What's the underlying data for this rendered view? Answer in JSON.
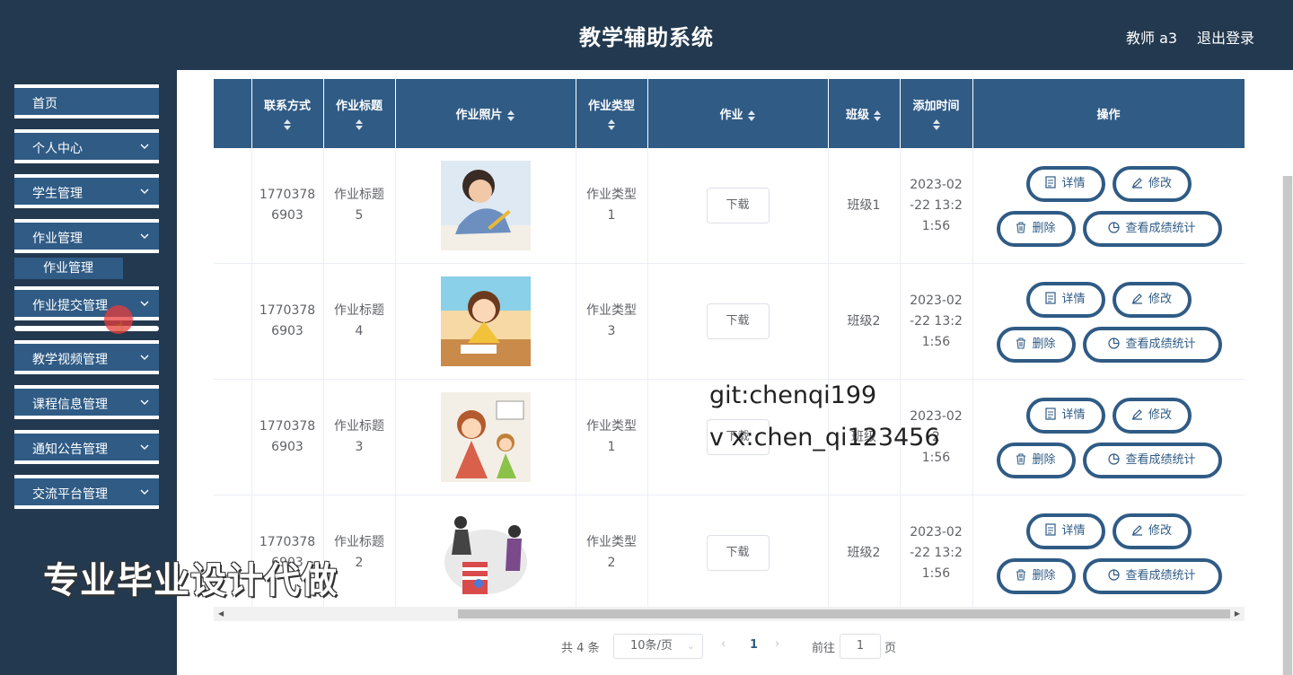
{
  "header": {
    "title": "教学辅助系统",
    "user": "教师 a3",
    "logout": "退出登录"
  },
  "sidebar": {
    "items": [
      {
        "label": "首页",
        "expandable": false
      },
      {
        "label": "个人中心",
        "expandable": true
      },
      {
        "label": "学生管理",
        "expandable": true
      },
      {
        "label": "作业管理",
        "expandable": true,
        "children": [
          "作业管理"
        ]
      },
      {
        "label": "作业提交管理",
        "expandable": true
      },
      {
        "label": "教学视频管理",
        "expandable": true
      },
      {
        "label": "课程信息管理",
        "expandable": true
      },
      {
        "label": "通知公告管理",
        "expandable": true
      },
      {
        "label": "交流平台管理",
        "expandable": true
      }
    ]
  },
  "table": {
    "columns": [
      "联系方式",
      "作业标题",
      "作业照片",
      "作业类型",
      "作业",
      "班级",
      "添加时间",
      "操作"
    ],
    "rows": [
      {
        "phone": "17703786903",
        "title": "作业标题5",
        "photo": "photo-girl-writing",
        "type": "作业类型1",
        "file": "下载",
        "class": "班级1",
        "time": "2023-02-22 13:21:56"
      },
      {
        "phone": "17703786903",
        "title": "作业标题4",
        "photo": "photo-cartoon-girl-desk",
        "type": "作业类型3",
        "file": "下载",
        "class": "班级2",
        "time": "2023-02-22 13:21:56"
      },
      {
        "phone": "17703786903",
        "title": "作业标题3",
        "photo": "photo-cartoon-mother-child",
        "type": "作业类型1",
        "file": "下载",
        "class": "班级",
        "time": "2023-02-22 13:21:56"
      },
      {
        "phone": "17703786903",
        "title": "作业标题2",
        "photo": "photo-cartoon-books",
        "type": "作业类型2",
        "file": "下载",
        "class": "班级2",
        "time": "2023-02-22 13:21:56"
      }
    ],
    "row_display": [
      {
        "phone": [
          "1770378",
          "6903"
        ],
        "title": [
          "作业标题",
          "5"
        ],
        "type": [
          "作业类型",
          "1"
        ],
        "time": [
          "2023-02",
          "-22 13:2",
          "1:56"
        ]
      },
      {
        "phone": [
          "1770378",
          "6903"
        ],
        "title": [
          "作业标题",
          "4"
        ],
        "type": [
          "作业类型",
          "3"
        ],
        "time": [
          "2023-02",
          "-22 13:2",
          "1:56"
        ]
      },
      {
        "phone": [
          "1770378",
          "6903"
        ],
        "title": [
          "作业标题",
          "3"
        ],
        "type": [
          "作业类型",
          "1"
        ],
        "time": [
          "2023-02",
          "2",
          "1:56"
        ]
      },
      {
        "phone": [
          "1770378",
          "6903"
        ],
        "title": [
          "作业标题",
          "2"
        ],
        "type": [
          "作业类型",
          "2"
        ],
        "time": [
          "2023-02",
          "-22 13:2",
          "1:56"
        ]
      }
    ],
    "actions": {
      "detail": "详情",
      "edit": "修改",
      "delete": "删除",
      "stats": "查看成绩统计"
    }
  },
  "pagination": {
    "total": "共 4 条",
    "page_size": "10条/页",
    "current": "1",
    "goto_label": "前往",
    "goto_value": "1",
    "page_unit": "页"
  },
  "overlays": {
    "git": "git:chenqi199",
    "wx": "v x:chen_qi123456",
    "banner": "专业毕业设计代做"
  },
  "colors": {
    "header_bg": "#23394f",
    "accent": "#2f5b85",
    "main_bg": "#ffffff"
  }
}
